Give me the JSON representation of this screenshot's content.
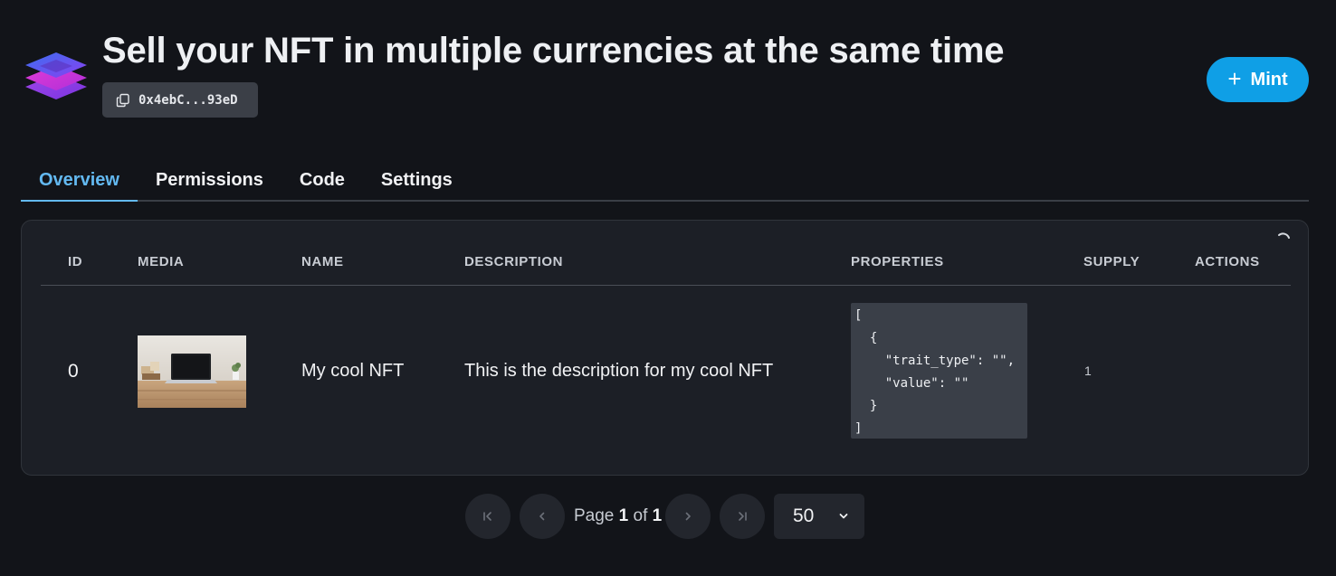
{
  "header": {
    "title": "Sell your NFT in multiple currencies at the same time",
    "address": "0x4ebC...93eD",
    "mint_label": "Mint",
    "mint_icon": "plus-icon",
    "copy_icon": "copy-icon",
    "logo_icon": "layers-logo-icon"
  },
  "tabs": [
    {
      "label": "Overview",
      "active": true
    },
    {
      "label": "Permissions",
      "active": false
    },
    {
      "label": "Code",
      "active": false
    },
    {
      "label": "Settings",
      "active": false
    }
  ],
  "table": {
    "columns": [
      "ID",
      "MEDIA",
      "NAME",
      "DESCRIPTION",
      "PROPERTIES",
      "SUPPLY",
      "ACTIONS"
    ],
    "rows": [
      {
        "id": "0",
        "media": "laptop-on-desk-image",
        "name": "My cool NFT",
        "description": "This is the description for my cool NFT",
        "properties": "[\n  {\n    \"trait_type\": \"\",\n    \"value\": \"\"\n  }\n]",
        "supply": "1",
        "actions": ""
      }
    ],
    "loading_icon": "spinner-icon"
  },
  "pagination": {
    "page_label": "Page",
    "current_page": "1",
    "of_label": "of",
    "total_pages": "1",
    "page_size": "50"
  },
  "colors": {
    "background": "#121419",
    "card": "#1c1f26",
    "accent": "#0f9fe6",
    "active_tab": "#63b9f1"
  }
}
